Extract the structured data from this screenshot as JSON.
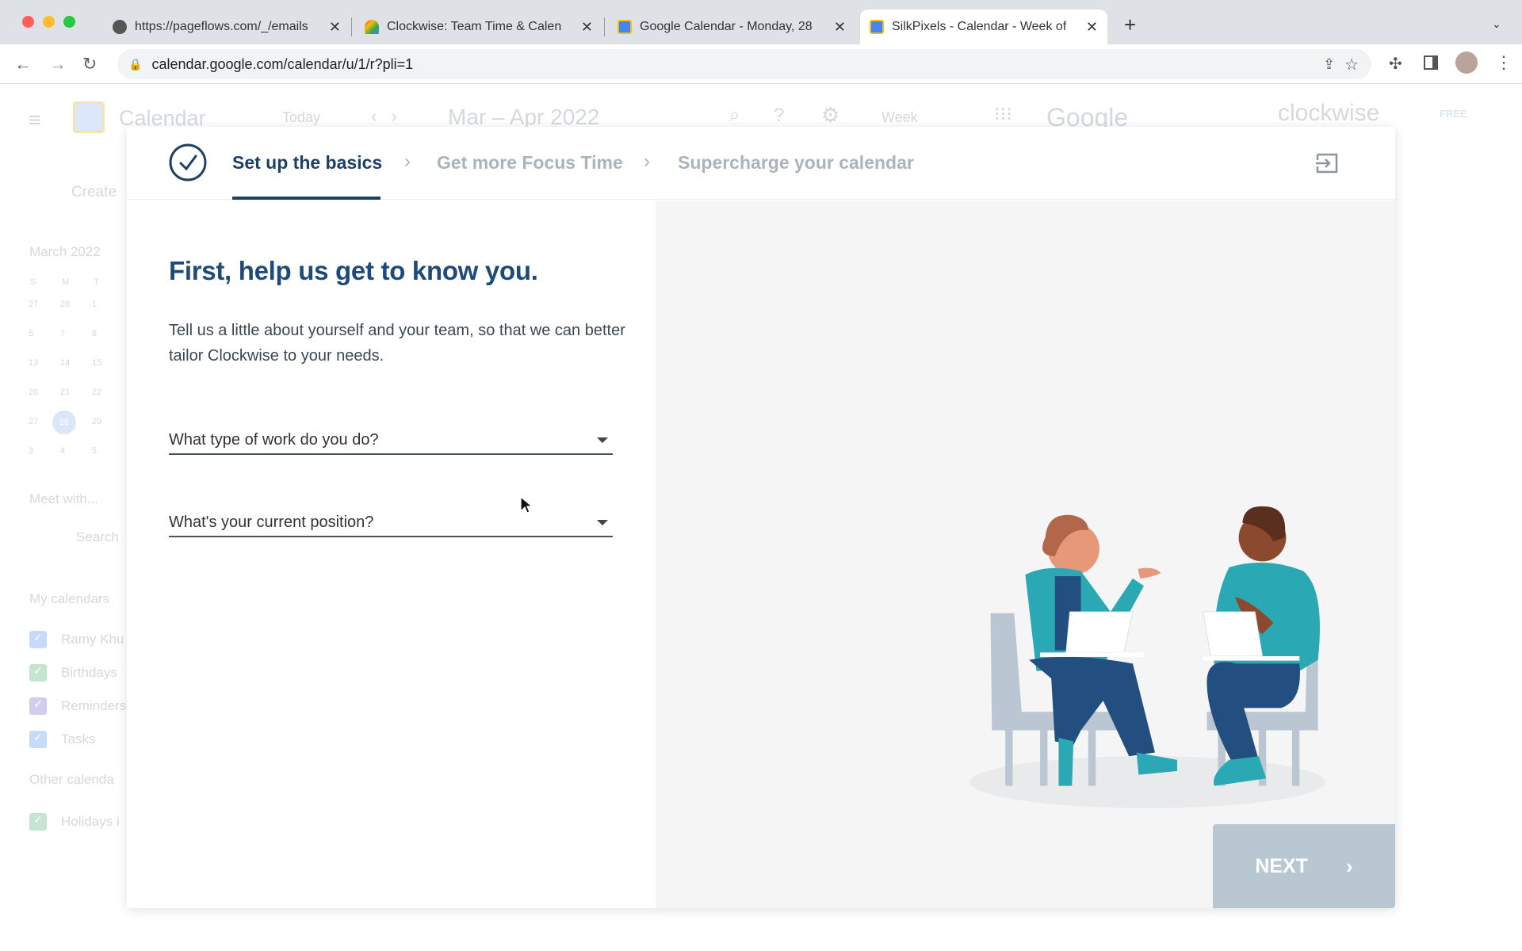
{
  "browser": {
    "tabs": [
      {
        "title": "https://pageflows.com/_/emails",
        "icon": "globe-icon"
      },
      {
        "title": "Clockwise: Team Time & Calen",
        "icon": "clockwise-icon"
      },
      {
        "title": "Google Calendar - Monday, 28",
        "icon": "google-calendar-icon"
      },
      {
        "title": "SilkPixels - Calendar - Week of",
        "icon": "google-calendar-icon",
        "active": true
      }
    ],
    "url": "calendar.google.com/calendar/u/1/r?pli=1"
  },
  "background": {
    "app_name": "Calendar",
    "today": "Today",
    "range": "Mar – Apr 2022",
    "view": "Week",
    "google": "Google",
    "clockwise": "clockwise",
    "badge": "FREE",
    "create": "Create",
    "month": "March 2022",
    "weekdays": [
      "S",
      "M",
      "T"
    ],
    "days": [
      [
        "27",
        "28",
        "1"
      ],
      [
        "6",
        "7",
        "8"
      ],
      [
        "13",
        "14",
        "15"
      ],
      [
        "20",
        "21",
        "22"
      ],
      [
        "27",
        "28",
        "29"
      ],
      [
        "3",
        "4",
        "5"
      ]
    ],
    "meet_with": "Meet with...",
    "search": "Search",
    "my_calendars": "My calendars",
    "calendars": [
      {
        "name": "Ramy Khu",
        "color": "#c6dafc"
      },
      {
        "name": "Birthdays",
        "color": "#c4e6cf"
      },
      {
        "name": "Reminders",
        "color": "#d2cdef"
      },
      {
        "name": "Tasks",
        "color": "#c6dafc"
      }
    ],
    "other_calendars": "Other calenda",
    "other": [
      {
        "name": "Holidays i",
        "color": "#c4e6cf"
      }
    ]
  },
  "onboarding": {
    "steps": [
      {
        "label": "Set up the basics",
        "active": true
      },
      {
        "label": "Get more Focus Time"
      },
      {
        "label": "Supercharge your calendar"
      }
    ],
    "title": "First, help us get to know you.",
    "description": "Tell us a little about yourself and your team, so that we can better tailor Clockwise to your needs.",
    "fields": [
      {
        "placeholder": "What type of work do you do?"
      },
      {
        "placeholder": "What's your current position?"
      }
    ],
    "next_label": "NEXT",
    "colors": {
      "primary": "#1e4a7a",
      "inactive_step": "#a9b4bd",
      "next_disabled": "#b8c7d2"
    }
  }
}
